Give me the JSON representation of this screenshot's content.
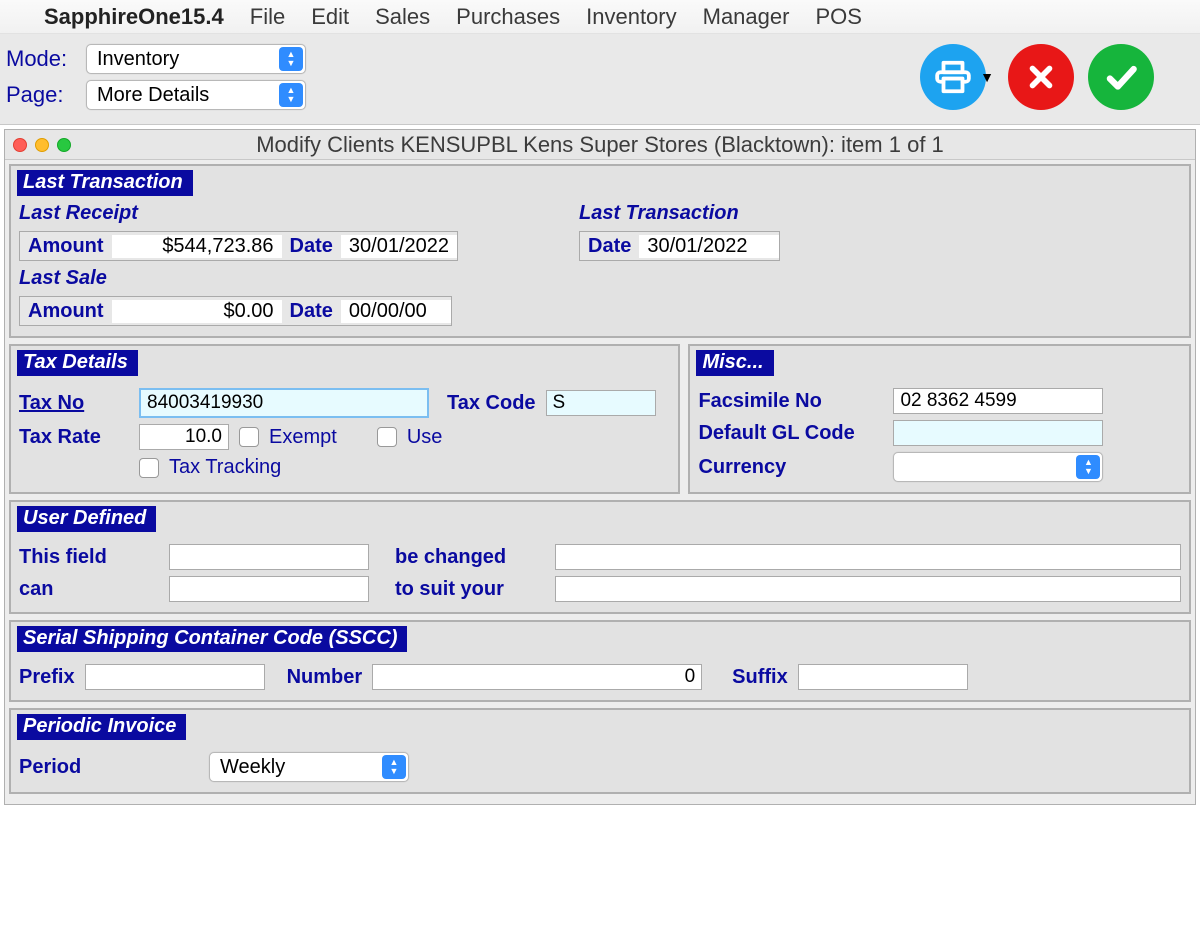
{
  "menubar": {
    "app_name": "SapphireOne15.4",
    "items": [
      "File",
      "Edit",
      "Sales",
      "Purchases",
      "Inventory",
      "Manager",
      "POS"
    ]
  },
  "toolbar": {
    "mode_label": "Mode:",
    "mode_value": "Inventory",
    "page_label": "Page:",
    "page_value": "More Details"
  },
  "window": {
    "title": "Modify Clients KENSUPBL Kens Super Stores (Blacktown): item 1  of  1"
  },
  "last_transaction": {
    "header": "Last Transaction",
    "receipt_label": "Last Receipt",
    "receipt_amount_label": "Amount",
    "receipt_amount": "$544,723.86",
    "receipt_date_label": "Date",
    "receipt_date": "30/01/2022",
    "sale_label": "Last Sale",
    "sale_amount_label": "Amount",
    "sale_amount": "$0.00",
    "sale_date_label": "Date",
    "sale_date": "00/00/00",
    "right_header": "Last Transaction",
    "right_date_label": "Date",
    "right_date": "30/01/2022"
  },
  "tax": {
    "header": "Tax Details",
    "tax_no_label": "Tax No",
    "tax_no": "84003419930",
    "tax_code_label": "Tax Code",
    "tax_code": "S",
    "tax_rate_label": "Tax Rate",
    "tax_rate": "10.0",
    "exempt_label": "Exempt",
    "use_label": "Use",
    "tracking_label": "Tax Tracking"
  },
  "misc": {
    "header": "Misc...",
    "fax_label": "Facsimile No",
    "fax": "02 8362 4599",
    "gl_label": "Default GL Code",
    "gl": "",
    "currency_label": "Currency",
    "currency": ""
  },
  "user_defined": {
    "header": "User Defined",
    "f1_label": "This field",
    "f1_value": "",
    "f2_label": "be changed",
    "f2_value": "",
    "f3_label": "can",
    "f3_value": "",
    "f4_label": "to suit your",
    "f4_value": ""
  },
  "sscc": {
    "header": "Serial Shipping Container Code (SSCC)",
    "prefix_label": "Prefix",
    "prefix": "",
    "number_label": "Number",
    "number": "0",
    "suffix_label": "Suffix",
    "suffix": ""
  },
  "periodic": {
    "header": "Periodic Invoice",
    "period_label": "Period",
    "period_value": "Weekly"
  }
}
